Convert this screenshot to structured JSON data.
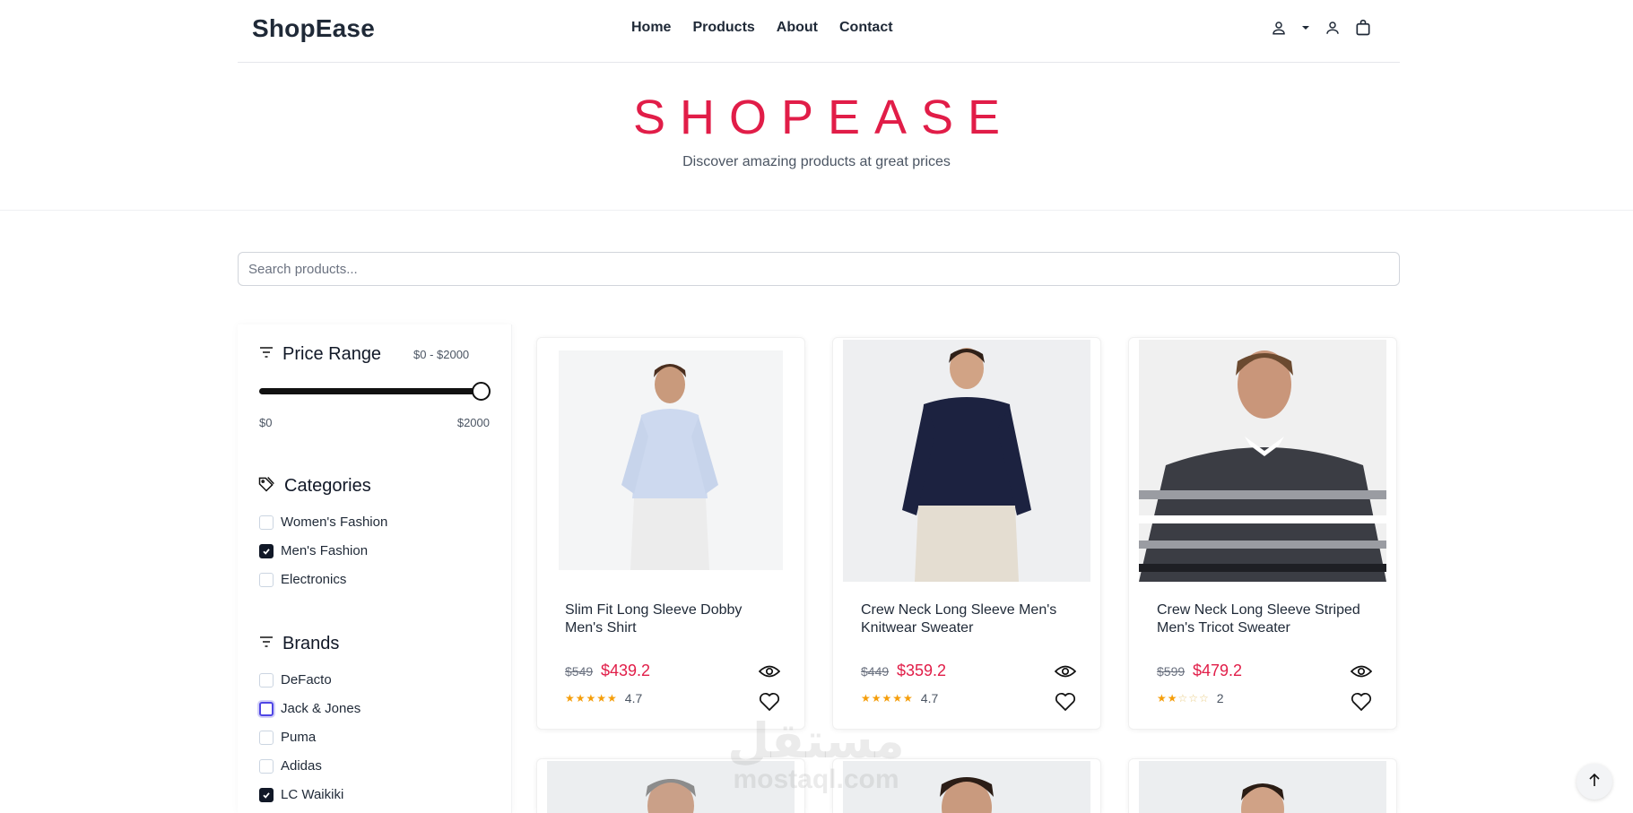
{
  "nav": {
    "logo": "ShopEase",
    "links": [
      "Home",
      "Products",
      "About",
      "Contact"
    ]
  },
  "hero": {
    "title": "SHOPEASE",
    "subtitle": "Discover amazing products at great prices"
  },
  "search": {
    "placeholder": "Search products..."
  },
  "filters": {
    "price": {
      "title": "Price Range",
      "label": "$0 - $2000",
      "min_label": "$0",
      "max_label": "$2000",
      "value_fraction": 1.0
    },
    "categories": {
      "title": "Categories",
      "items": [
        {
          "label": "Women's Fashion",
          "checked": false
        },
        {
          "label": "Men's Fashion",
          "checked": true
        },
        {
          "label": "Electronics",
          "checked": false
        }
      ]
    },
    "brands": {
      "title": "Brands",
      "items": [
        {
          "label": "DeFacto",
          "checked": false
        },
        {
          "label": "Jack & Jones",
          "checked": false,
          "focused": true
        },
        {
          "label": "Puma",
          "checked": false
        },
        {
          "label": "Adidas",
          "checked": false
        },
        {
          "label": "LC Waikiki",
          "checked": true
        }
      ]
    }
  },
  "products": [
    {
      "title": "Slim Fit Long Sleeve Dobby Men's Shirt",
      "old_price": "$549",
      "price": "$439.2",
      "rating": "4.7",
      "stars_filled": 5
    },
    {
      "title": "Crew Neck Long Sleeve Men's Knitwear Sweater",
      "old_price": "$449",
      "price": "$359.2",
      "rating": "4.7",
      "stars_filled": 5
    },
    {
      "title": "Crew Neck Long Sleeve Striped Men's Tricot Sweater",
      "old_price": "$599",
      "price": "$479.2",
      "rating": "2",
      "stars_filled": 2
    }
  ],
  "watermark": {
    "arabic": "مستقل",
    "latin": "mostaql.com"
  },
  "colors": {
    "accent": "#e11d48",
    "star": "#f59e0b",
    "text": "#1f2937"
  }
}
